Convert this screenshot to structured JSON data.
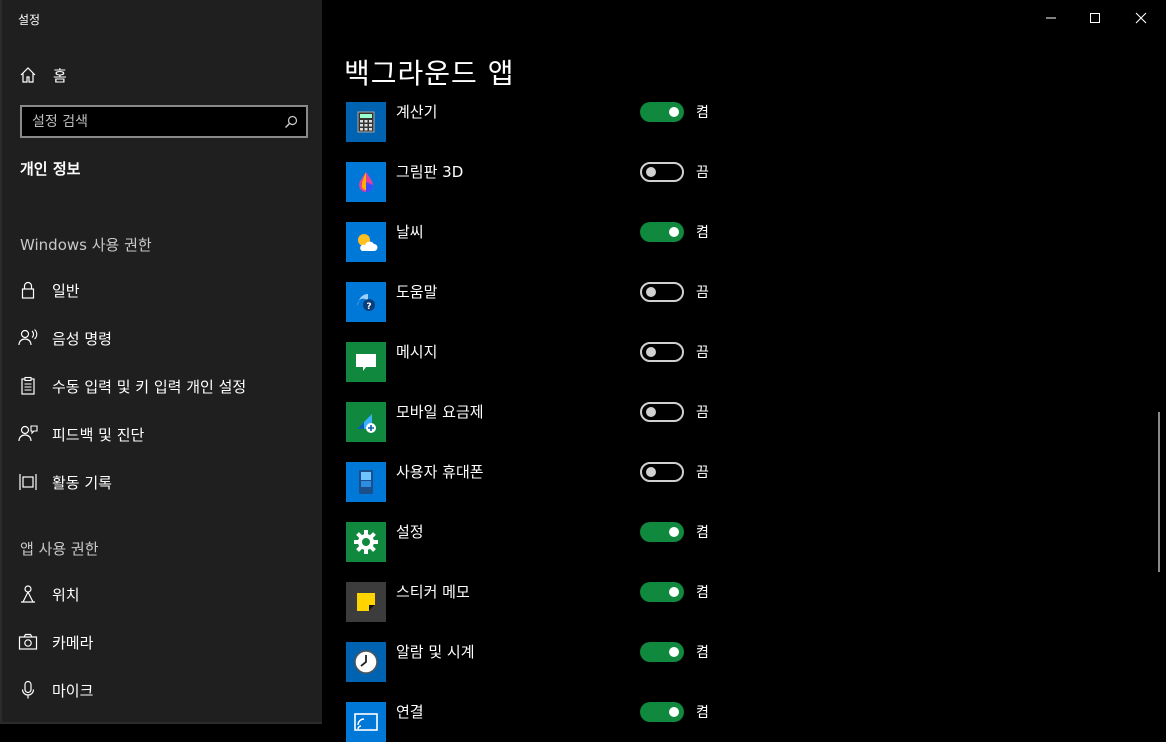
{
  "window": {
    "title": "설정"
  },
  "sidebar": {
    "home_label": "홈",
    "search": {
      "placeholder": "설정 검색"
    },
    "current_section": "개인 정보",
    "windows_header": "Windows 사용 권한",
    "windows_items": [
      {
        "label": "일반",
        "icon": "lock-icon"
      },
      {
        "label": "음성 명령",
        "icon": "voice-icon"
      },
      {
        "label": "수동 입력 및 키 입력 개인 설정",
        "icon": "clipboard-icon"
      },
      {
        "label": "피드백 및 진단",
        "icon": "feedback-icon"
      },
      {
        "label": "활동 기록",
        "icon": "timeline-icon"
      }
    ],
    "app_header": "앱 사용 권한",
    "app_items": [
      {
        "label": "위치",
        "icon": "location-icon"
      },
      {
        "label": "카메라",
        "icon": "camera-icon"
      },
      {
        "label": "마이크",
        "icon": "microphone-icon"
      }
    ]
  },
  "main": {
    "title": "백그라운드 앱",
    "apps": [
      {
        "name": "계산기",
        "state": "켬",
        "on": true,
        "icon": "calculator-icon",
        "tile": "#0063b1"
      },
      {
        "name": "그림판 3D",
        "state": "끔",
        "on": false,
        "icon": "paint3d-icon",
        "tile": "#0078d7"
      },
      {
        "name": "날씨",
        "state": "켬",
        "on": true,
        "icon": "weather-icon",
        "tile": "#0078d7"
      },
      {
        "name": "도움말",
        "state": "끔",
        "on": false,
        "icon": "help-icon",
        "tile": "#0078d7"
      },
      {
        "name": "메시지",
        "state": "끔",
        "on": false,
        "icon": "messaging-icon",
        "tile": "#10893e"
      },
      {
        "name": "모바일 요금제",
        "state": "끔",
        "on": false,
        "icon": "mobile-plans-icon",
        "tile": "#10893e"
      },
      {
        "name": "사용자 휴대폰",
        "state": "끔",
        "on": false,
        "icon": "phone-icon",
        "tile": "#0078d7"
      },
      {
        "name": "설정",
        "state": "켬",
        "on": true,
        "icon": "gear-icon",
        "tile": "#10893e"
      },
      {
        "name": "스티커 메모",
        "state": "켬",
        "on": true,
        "icon": "sticky-notes-icon",
        "tile": "#3c3c3c"
      },
      {
        "name": "알람 및 시계",
        "state": "켬",
        "on": true,
        "icon": "clock-icon",
        "tile": "#0063b1"
      },
      {
        "name": "연결",
        "state": "켬",
        "on": true,
        "icon": "connect-icon",
        "tile": "#0078d7"
      }
    ]
  },
  "colors": {
    "toggle_on": "#10893e",
    "sidebar_bg": "#1f1f1f",
    "page_bg": "#000000"
  }
}
